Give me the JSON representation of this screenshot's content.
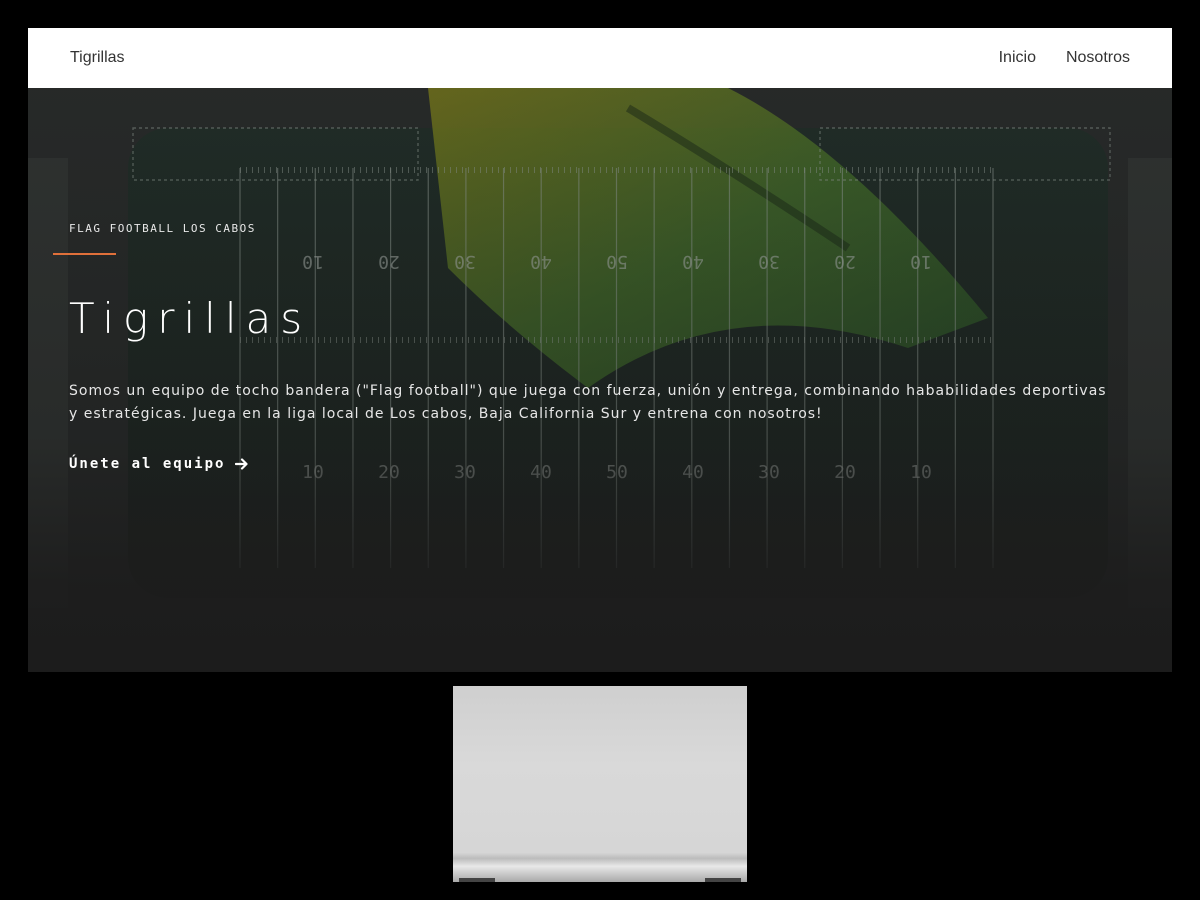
{
  "navbar": {
    "brand": "Tigrillas",
    "links": [
      {
        "label": "Inicio"
      },
      {
        "label": "Nosotros"
      }
    ]
  },
  "hero": {
    "eyebrow": "Flag football Los Cabos",
    "title": "Tigrillas",
    "description": "Somos un equipo de tocho bandera (\"Flag football\") que juega con fuerza, unión y entrega, combinando hababilidades deportivas y estratégicas. Juega en la liga local de Los cabos, Baja California Sur y entrena con nosotros!",
    "cta_label": "Únete al equipo",
    "cta_icon": "arrow-right-icon",
    "field_numbers_top": [
      "10",
      "20",
      "30",
      "40",
      "50",
      "40",
      "30",
      "20",
      "10"
    ],
    "field_numbers_bottom": [
      "10",
      "20",
      "30",
      "40",
      "50",
      "40",
      "30",
      "20",
      "10"
    ]
  },
  "colors": {
    "accent": "#e0703a",
    "navbar_bg": "#ffffff",
    "hero_dark": "#1c1c1c",
    "field_green": "#2a4a2e",
    "flag_yellow": "#c9b21e"
  }
}
